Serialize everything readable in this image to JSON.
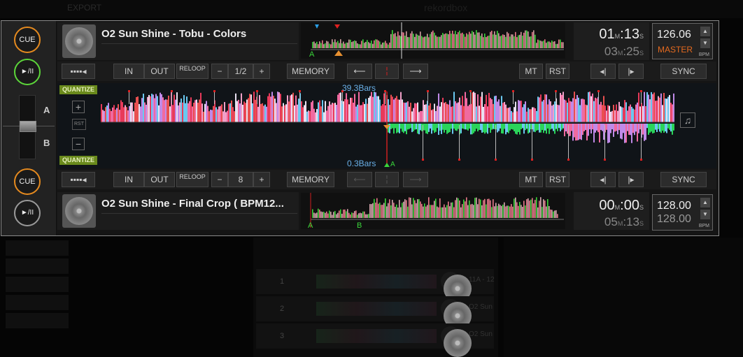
{
  "background": {
    "export_label": "EXPORT",
    "logo_text": "rekordbox",
    "track_rows": [
      {
        "num": "1",
        "label": "11A - 12"
      },
      {
        "num": "2",
        "label": "O2 Sun"
      },
      {
        "num": "3",
        "label": "O2 Sun"
      }
    ]
  },
  "left_controls": {
    "cue_label": "CUE",
    "play_label": "►/II",
    "deck_a": "A",
    "deck_b": "B"
  },
  "deck1": {
    "title": "O2 Sun Shine - Tobu - Colors",
    "elapsed_min": "01",
    "elapsed_sec": "13",
    "remain_min": "03",
    "remain_sec": "25",
    "bpm": "126.06",
    "bpm_state": "MASTER",
    "bpm_unit": "BPM",
    "loop_beats": "1/2",
    "cue_markers": [
      "A"
    ]
  },
  "deck2": {
    "title": "O2 Sun Shine - Final Crop ( BPM12...",
    "elapsed_min": "00",
    "elapsed_sec": "00",
    "remain_min": "05",
    "remain_sec": "13",
    "bpm": "128.00",
    "bpm_original": "128.00",
    "bpm_unit": "BPM",
    "loop_beats": "8",
    "cue_markers": [
      "A",
      "B"
    ]
  },
  "controls": {
    "in_label": "IN",
    "out_label": "OUT",
    "reloop_label": "RELOOP",
    "minus": "−",
    "plus": "+",
    "memory_label": "MEMORY",
    "mt_label": "MT",
    "rst_label": "RST",
    "sync_label": "SYNC"
  },
  "waveform": {
    "quantize_label": "QUANTIZE",
    "bars_top": "39.3Bars",
    "bars_bottom": "0.3Bars",
    "cue_marker": "A",
    "rst_small": "RST",
    "units": {
      "m": "M",
      "s": "S"
    }
  }
}
